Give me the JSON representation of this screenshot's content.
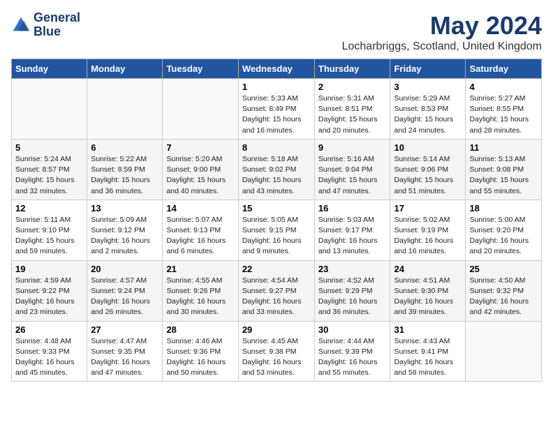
{
  "logo": {
    "line1": "General",
    "line2": "Blue"
  },
  "title": "May 2024",
  "location": "Locharbriggs, Scotland, United Kingdom",
  "headers": [
    "Sunday",
    "Monday",
    "Tuesday",
    "Wednesday",
    "Thursday",
    "Friday",
    "Saturday"
  ],
  "weeks": [
    [
      {
        "day": "",
        "info": ""
      },
      {
        "day": "",
        "info": ""
      },
      {
        "day": "",
        "info": ""
      },
      {
        "day": "1",
        "info": "Sunrise: 5:33 AM\nSunset: 8:49 PM\nDaylight: 15 hours\nand 16 minutes."
      },
      {
        "day": "2",
        "info": "Sunrise: 5:31 AM\nSunset: 8:51 PM\nDaylight: 15 hours\nand 20 minutes."
      },
      {
        "day": "3",
        "info": "Sunrise: 5:29 AM\nSunset: 8:53 PM\nDaylight: 15 hours\nand 24 minutes."
      },
      {
        "day": "4",
        "info": "Sunrise: 5:27 AM\nSunset: 8:55 PM\nDaylight: 15 hours\nand 28 minutes."
      }
    ],
    [
      {
        "day": "5",
        "info": "Sunrise: 5:24 AM\nSunset: 8:57 PM\nDaylight: 15 hours\nand 32 minutes."
      },
      {
        "day": "6",
        "info": "Sunrise: 5:22 AM\nSunset: 8:59 PM\nDaylight: 15 hours\nand 36 minutes."
      },
      {
        "day": "7",
        "info": "Sunrise: 5:20 AM\nSunset: 9:00 PM\nDaylight: 15 hours\nand 40 minutes."
      },
      {
        "day": "8",
        "info": "Sunrise: 5:18 AM\nSunset: 9:02 PM\nDaylight: 15 hours\nand 43 minutes."
      },
      {
        "day": "9",
        "info": "Sunrise: 5:16 AM\nSunset: 9:04 PM\nDaylight: 15 hours\nand 47 minutes."
      },
      {
        "day": "10",
        "info": "Sunrise: 5:14 AM\nSunset: 9:06 PM\nDaylight: 15 hours\nand 51 minutes."
      },
      {
        "day": "11",
        "info": "Sunrise: 5:13 AM\nSunset: 9:08 PM\nDaylight: 15 hours\nand 55 minutes."
      }
    ],
    [
      {
        "day": "12",
        "info": "Sunrise: 5:11 AM\nSunset: 9:10 PM\nDaylight: 15 hours\nand 59 minutes."
      },
      {
        "day": "13",
        "info": "Sunrise: 5:09 AM\nSunset: 9:12 PM\nDaylight: 16 hours\nand 2 minutes."
      },
      {
        "day": "14",
        "info": "Sunrise: 5:07 AM\nSunset: 9:13 PM\nDaylight: 16 hours\nand 6 minutes."
      },
      {
        "day": "15",
        "info": "Sunrise: 5:05 AM\nSunset: 9:15 PM\nDaylight: 16 hours\nand 9 minutes."
      },
      {
        "day": "16",
        "info": "Sunrise: 5:03 AM\nSunset: 9:17 PM\nDaylight: 16 hours\nand 13 minutes."
      },
      {
        "day": "17",
        "info": "Sunrise: 5:02 AM\nSunset: 9:19 PM\nDaylight: 16 hours\nand 16 minutes."
      },
      {
        "day": "18",
        "info": "Sunrise: 5:00 AM\nSunset: 9:20 PM\nDaylight: 16 hours\nand 20 minutes."
      }
    ],
    [
      {
        "day": "19",
        "info": "Sunrise: 4:59 AM\nSunset: 9:22 PM\nDaylight: 16 hours\nand 23 minutes."
      },
      {
        "day": "20",
        "info": "Sunrise: 4:57 AM\nSunset: 9:24 PM\nDaylight: 16 hours\nand 26 minutes."
      },
      {
        "day": "21",
        "info": "Sunrise: 4:55 AM\nSunset: 9:26 PM\nDaylight: 16 hours\nand 30 minutes."
      },
      {
        "day": "22",
        "info": "Sunrise: 4:54 AM\nSunset: 9:27 PM\nDaylight: 16 hours\nand 33 minutes."
      },
      {
        "day": "23",
        "info": "Sunrise: 4:52 AM\nSunset: 9:29 PM\nDaylight: 16 hours\nand 36 minutes."
      },
      {
        "day": "24",
        "info": "Sunrise: 4:51 AM\nSunset: 9:30 PM\nDaylight: 16 hours\nand 39 minutes."
      },
      {
        "day": "25",
        "info": "Sunrise: 4:50 AM\nSunset: 9:32 PM\nDaylight: 16 hours\nand 42 minutes."
      }
    ],
    [
      {
        "day": "26",
        "info": "Sunrise: 4:48 AM\nSunset: 9:33 PM\nDaylight: 16 hours\nand 45 minutes."
      },
      {
        "day": "27",
        "info": "Sunrise: 4:47 AM\nSunset: 9:35 PM\nDaylight: 16 hours\nand 47 minutes."
      },
      {
        "day": "28",
        "info": "Sunrise: 4:46 AM\nSunset: 9:36 PM\nDaylight: 16 hours\nand 50 minutes."
      },
      {
        "day": "29",
        "info": "Sunrise: 4:45 AM\nSunset: 9:38 PM\nDaylight: 16 hours\nand 53 minutes."
      },
      {
        "day": "30",
        "info": "Sunrise: 4:44 AM\nSunset: 9:39 PM\nDaylight: 16 hours\nand 55 minutes."
      },
      {
        "day": "31",
        "info": "Sunrise: 4:43 AM\nSunset: 9:41 PM\nDaylight: 16 hours\nand 58 minutes."
      },
      {
        "day": "",
        "info": ""
      }
    ]
  ]
}
